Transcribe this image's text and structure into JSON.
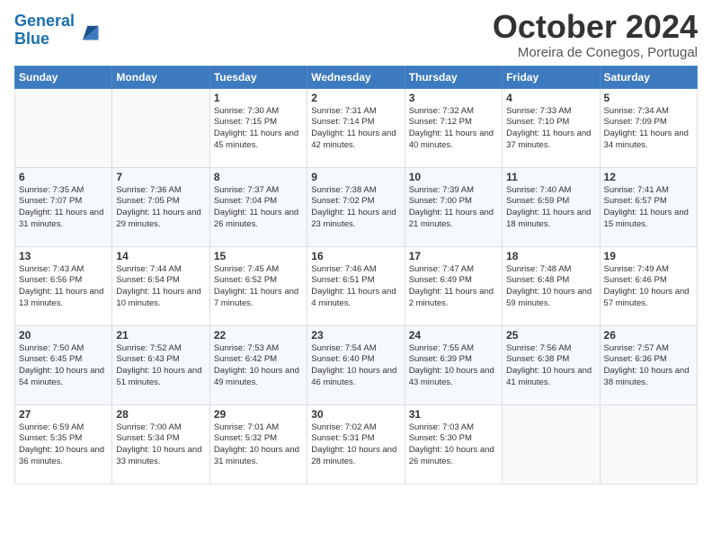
{
  "logo": {
    "line1": "General",
    "line2": "Blue"
  },
  "title": "October 2024",
  "location": "Moreira de Conegos, Portugal",
  "weekdays": [
    "Sunday",
    "Monday",
    "Tuesday",
    "Wednesday",
    "Thursday",
    "Friday",
    "Saturday"
  ],
  "weeks": [
    [
      {
        "day": "",
        "info": ""
      },
      {
        "day": "",
        "info": ""
      },
      {
        "day": "1",
        "info": "Sunrise: 7:30 AM\nSunset: 7:15 PM\nDaylight: 11 hours and 45 minutes."
      },
      {
        "day": "2",
        "info": "Sunrise: 7:31 AM\nSunset: 7:14 PM\nDaylight: 11 hours and 42 minutes."
      },
      {
        "day": "3",
        "info": "Sunrise: 7:32 AM\nSunset: 7:12 PM\nDaylight: 11 hours and 40 minutes."
      },
      {
        "day": "4",
        "info": "Sunrise: 7:33 AM\nSunset: 7:10 PM\nDaylight: 11 hours and 37 minutes."
      },
      {
        "day": "5",
        "info": "Sunrise: 7:34 AM\nSunset: 7:09 PM\nDaylight: 11 hours and 34 minutes."
      }
    ],
    [
      {
        "day": "6",
        "info": "Sunrise: 7:35 AM\nSunset: 7:07 PM\nDaylight: 11 hours and 31 minutes."
      },
      {
        "day": "7",
        "info": "Sunrise: 7:36 AM\nSunset: 7:05 PM\nDaylight: 11 hours and 29 minutes."
      },
      {
        "day": "8",
        "info": "Sunrise: 7:37 AM\nSunset: 7:04 PM\nDaylight: 11 hours and 26 minutes."
      },
      {
        "day": "9",
        "info": "Sunrise: 7:38 AM\nSunset: 7:02 PM\nDaylight: 11 hours and 23 minutes."
      },
      {
        "day": "10",
        "info": "Sunrise: 7:39 AM\nSunset: 7:00 PM\nDaylight: 11 hours and 21 minutes."
      },
      {
        "day": "11",
        "info": "Sunrise: 7:40 AM\nSunset: 6:59 PM\nDaylight: 11 hours and 18 minutes."
      },
      {
        "day": "12",
        "info": "Sunrise: 7:41 AM\nSunset: 6:57 PM\nDaylight: 11 hours and 15 minutes."
      }
    ],
    [
      {
        "day": "13",
        "info": "Sunrise: 7:43 AM\nSunset: 6:56 PM\nDaylight: 11 hours and 13 minutes."
      },
      {
        "day": "14",
        "info": "Sunrise: 7:44 AM\nSunset: 6:54 PM\nDaylight: 11 hours and 10 minutes."
      },
      {
        "day": "15",
        "info": "Sunrise: 7:45 AM\nSunset: 6:52 PM\nDaylight: 11 hours and 7 minutes."
      },
      {
        "day": "16",
        "info": "Sunrise: 7:46 AM\nSunset: 6:51 PM\nDaylight: 11 hours and 4 minutes."
      },
      {
        "day": "17",
        "info": "Sunrise: 7:47 AM\nSunset: 6:49 PM\nDaylight: 11 hours and 2 minutes."
      },
      {
        "day": "18",
        "info": "Sunrise: 7:48 AM\nSunset: 6:48 PM\nDaylight: 10 hours and 59 minutes."
      },
      {
        "day": "19",
        "info": "Sunrise: 7:49 AM\nSunset: 6:46 PM\nDaylight: 10 hours and 57 minutes."
      }
    ],
    [
      {
        "day": "20",
        "info": "Sunrise: 7:50 AM\nSunset: 6:45 PM\nDaylight: 10 hours and 54 minutes."
      },
      {
        "day": "21",
        "info": "Sunrise: 7:52 AM\nSunset: 6:43 PM\nDaylight: 10 hours and 51 minutes."
      },
      {
        "day": "22",
        "info": "Sunrise: 7:53 AM\nSunset: 6:42 PM\nDaylight: 10 hours and 49 minutes."
      },
      {
        "day": "23",
        "info": "Sunrise: 7:54 AM\nSunset: 6:40 PM\nDaylight: 10 hours and 46 minutes."
      },
      {
        "day": "24",
        "info": "Sunrise: 7:55 AM\nSunset: 6:39 PM\nDaylight: 10 hours and 43 minutes."
      },
      {
        "day": "25",
        "info": "Sunrise: 7:56 AM\nSunset: 6:38 PM\nDaylight: 10 hours and 41 minutes."
      },
      {
        "day": "26",
        "info": "Sunrise: 7:57 AM\nSunset: 6:36 PM\nDaylight: 10 hours and 38 minutes."
      }
    ],
    [
      {
        "day": "27",
        "info": "Sunrise: 6:59 AM\nSunset: 5:35 PM\nDaylight: 10 hours and 36 minutes."
      },
      {
        "day": "28",
        "info": "Sunrise: 7:00 AM\nSunset: 5:34 PM\nDaylight: 10 hours and 33 minutes."
      },
      {
        "day": "29",
        "info": "Sunrise: 7:01 AM\nSunset: 5:32 PM\nDaylight: 10 hours and 31 minutes."
      },
      {
        "day": "30",
        "info": "Sunrise: 7:02 AM\nSunset: 5:31 PM\nDaylight: 10 hours and 28 minutes."
      },
      {
        "day": "31",
        "info": "Sunrise: 7:03 AM\nSunset: 5:30 PM\nDaylight: 10 hours and 26 minutes."
      },
      {
        "day": "",
        "info": ""
      },
      {
        "day": "",
        "info": ""
      }
    ]
  ]
}
